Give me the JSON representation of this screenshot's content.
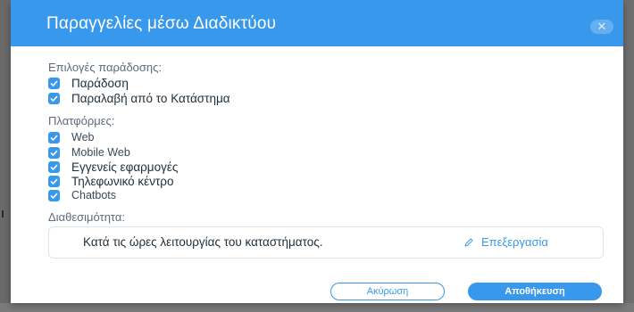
{
  "modal": {
    "title": "Παραγγελίες μέσω Διαδικτύου",
    "close_icon": "close-icon"
  },
  "delivery": {
    "label": "Επιλογές παράδοσης:",
    "options": [
      {
        "label": "Παράδοση",
        "checked": true
      },
      {
        "label": "Παραλαβή από το Κατάστημα",
        "checked": true
      }
    ]
  },
  "platforms": {
    "label": "Πλατφόρμες:",
    "options": [
      {
        "label": "Web",
        "checked": true
      },
      {
        "label": "Mobile Web",
        "checked": true
      },
      {
        "label": "Εγγενείς εφαρμογές",
        "checked": true
      },
      {
        "label": "Τηλεφωνικό κέντρο",
        "checked": true
      },
      {
        "label": "Chatbots",
        "checked": true
      }
    ]
  },
  "availability": {
    "label": "Διαθεσιμότητα:",
    "value": "Κατά τις ώρες λειτουργίας του καταστήματος.",
    "edit_label": "Επεξεργασία",
    "edit_icon": "pencil-icon"
  },
  "footer": {
    "cancel_label": "Ακύρωση",
    "save_label": "Αποθήκευση"
  },
  "colors": {
    "accent": "#3899ec",
    "header": "#3899ec",
    "backdrop": "#6f6f6f"
  }
}
